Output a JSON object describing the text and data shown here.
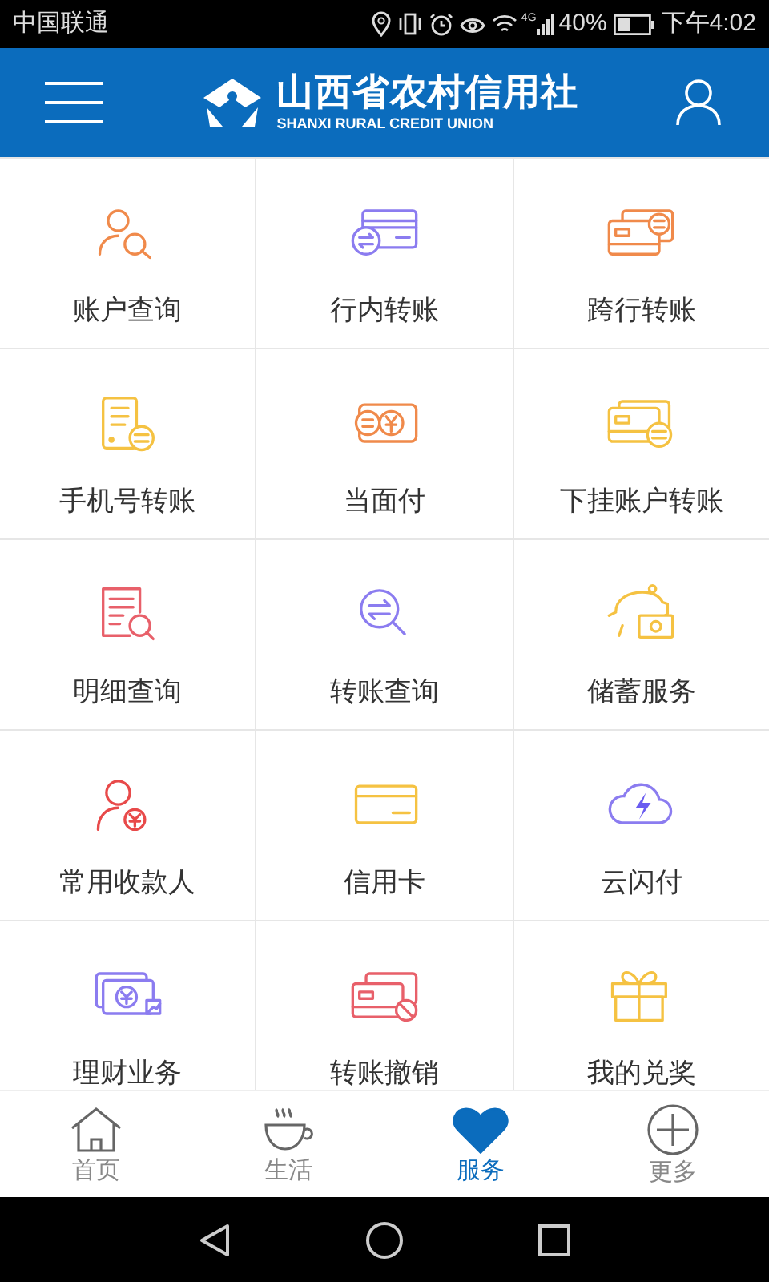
{
  "status_bar": {
    "carrier": "中国联通",
    "network": "4G",
    "battery": "40%",
    "time": "下午4:02"
  },
  "header": {
    "logo_title": "山西省农村信用社",
    "logo_subtitle": "SHANXI RURAL CREDIT UNION"
  },
  "services": [
    {
      "label": "账户查询",
      "kind": "person-search"
    },
    {
      "label": "行内转账",
      "kind": "card-transfer"
    },
    {
      "label": "跨行转账",
      "kind": "cards-transfer"
    },
    {
      "label": "手机号转账",
      "kind": "phone-transfer"
    },
    {
      "label": "当面付",
      "kind": "face-pay"
    },
    {
      "label": "下挂账户转账",
      "kind": "wallet-transfer"
    },
    {
      "label": "明细查询",
      "kind": "document-search"
    },
    {
      "label": "转账查询",
      "kind": "transfer-search"
    },
    {
      "label": "储蓄服务",
      "kind": "piggy-bank"
    },
    {
      "label": "常用收款人",
      "kind": "person-yuan"
    },
    {
      "label": "信用卡",
      "kind": "credit-card"
    },
    {
      "label": "云闪付",
      "kind": "cloud-flash"
    },
    {
      "label": "理财业务",
      "kind": "money-chart"
    },
    {
      "label": "转账撤销",
      "kind": "card-cancel"
    },
    {
      "label": "我的兑奖",
      "kind": "gift"
    }
  ],
  "tab_bar": [
    {
      "label": "首页",
      "kind": "home",
      "selected": false
    },
    {
      "label": "生活",
      "kind": "cup",
      "selected": false
    },
    {
      "label": "服务",
      "kind": "heart",
      "selected": true
    },
    {
      "label": "更多",
      "kind": "plus",
      "selected": false
    }
  ]
}
